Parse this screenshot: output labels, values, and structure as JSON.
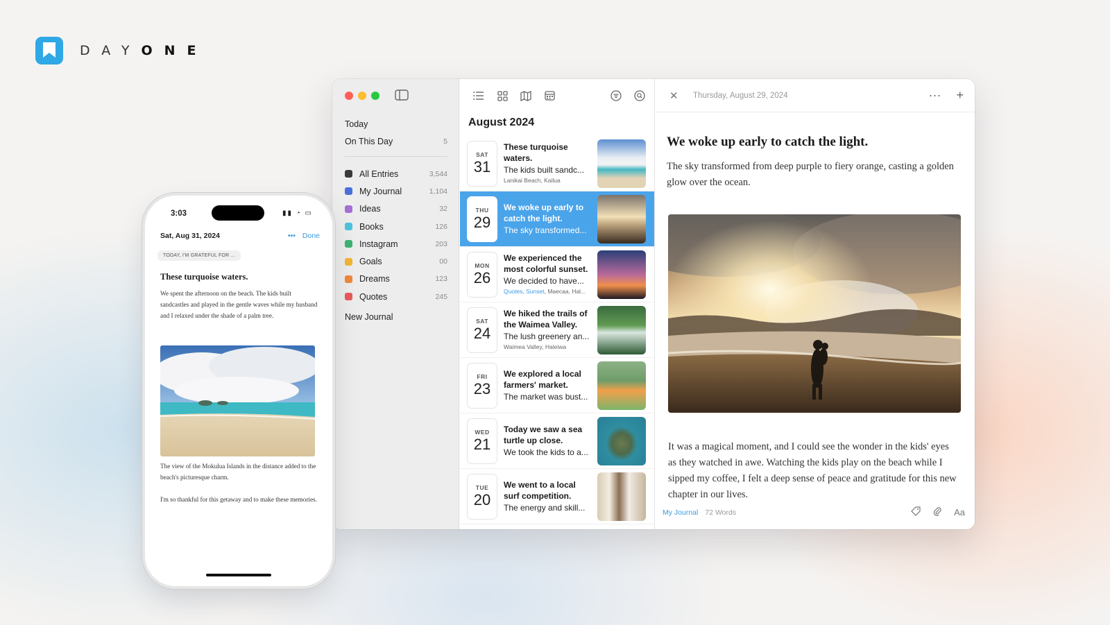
{
  "brand": {
    "name_light": "DAY",
    "name_bold": "ONE",
    "color": "#2fa8e6"
  },
  "sidebar": {
    "nav": [
      {
        "label": "Today",
        "count": ""
      },
      {
        "label": "On This Day",
        "count": "5"
      }
    ],
    "journals": [
      {
        "label": "All Entries",
        "count": "3,544",
        "color": "#3a3a3a"
      },
      {
        "label": "My Journal",
        "count": "1,104",
        "color": "#4a6fd8"
      },
      {
        "label": "Ideas",
        "count": "32",
        "color": "#a56fd6"
      },
      {
        "label": "Books",
        "count": "126",
        "color": "#4cc3dc"
      },
      {
        "label": "Instagram",
        "count": "203",
        "color": "#3cb371"
      },
      {
        "label": "Goals",
        "count": "00",
        "color": "#f2b632"
      },
      {
        "label": "Dreams",
        "count": "123",
        "color": "#f0883c"
      },
      {
        "label": "Quotes",
        "count": "245",
        "color": "#e85a5a"
      }
    ],
    "new_journal": "New Journal"
  },
  "list": {
    "month": "August 2024",
    "entries": [
      {
        "dow": "SAT",
        "day": "31",
        "title": "These turquoise waters.",
        "preview": "The kids built sandc...",
        "meta": "Lanikai Beach, Kailua",
        "tags": [],
        "selected": false,
        "thumb": "beach"
      },
      {
        "dow": "THU",
        "day": "29",
        "title": "We woke up early to catch the light.",
        "preview": "The sky transformed...",
        "meta": "",
        "tags": [],
        "selected": true,
        "thumb": "sunrise"
      },
      {
        "dow": "MON",
        "day": "26",
        "title": "We experienced the most colorful sunset.",
        "preview": "We decided to have...",
        "meta": "Maecaa, Hal...",
        "tags": [
          "Quotes",
          "Sunset"
        ],
        "selected": false,
        "thumb": "palms"
      },
      {
        "dow": "SAT",
        "day": "24",
        "title": "We hiked the  trails of the Waimea Valley.",
        "preview": "The lush greenery an...",
        "meta": "Waimea Valley, Haleiwa",
        "tags": [],
        "selected": false,
        "thumb": "waterfall"
      },
      {
        "dow": "FRI",
        "day": "23",
        "title": "We explored a local farmers' market.",
        "preview": "The market was bust...",
        "meta": "",
        "tags": [],
        "selected": false,
        "thumb": "market"
      },
      {
        "dow": "WED",
        "day": "21",
        "title": "Today we saw a sea turtle up close.",
        "preview": "We took the kids to a...",
        "meta": "",
        "tags": [],
        "selected": false,
        "thumb": "turtle"
      },
      {
        "dow": "TUE",
        "day": "20",
        "title": "We went to a local surf competition.",
        "preview": "The energy and skill...",
        "meta": "",
        "tags": [],
        "selected": false,
        "thumb": "surf"
      }
    ]
  },
  "detail": {
    "date": "Thursday, August 29, 2024",
    "title": "We woke up early to catch the light.",
    "paragraph1": "The sky transformed from deep purple to fiery orange, casting a golden glow over the ocean.",
    "paragraph2": "It was a magical moment, and I could see the wonder in the kids' eyes as they watched in awe. Watching the kids play on the beach while I sipped my coffee, I felt a deep sense of peace and gratitude for this new chapter in our lives.",
    "journal": "My Journal",
    "word_count": "72 Words",
    "format_label": "Aa"
  },
  "phone": {
    "time": "3:03",
    "date": "Sat, Aug 31, 2024",
    "done_label": "Done",
    "prompt": "TODAY, I'M GRATEFUL FOR ...",
    "title": "These turquoise waters.",
    "body1": "We spent the afternoon on the beach. The kids built sandcastles and played in the gentle waves while my husband and I relaxed under the shade of a palm tree.",
    "body2": "The view of the Mokulua Islands in the distance added to the beach's picturesque charm.",
    "body3": "I'm so thankful for this getaway and to make these memories."
  },
  "icons": [
    "sidebar-toggle-icon",
    "list-view-icon",
    "grid-view-icon",
    "map-view-icon",
    "calendar-view-icon",
    "filter-icon",
    "search-icon",
    "close-icon",
    "more-icon",
    "plus-icon",
    "tag-icon",
    "attachment-icon"
  ]
}
